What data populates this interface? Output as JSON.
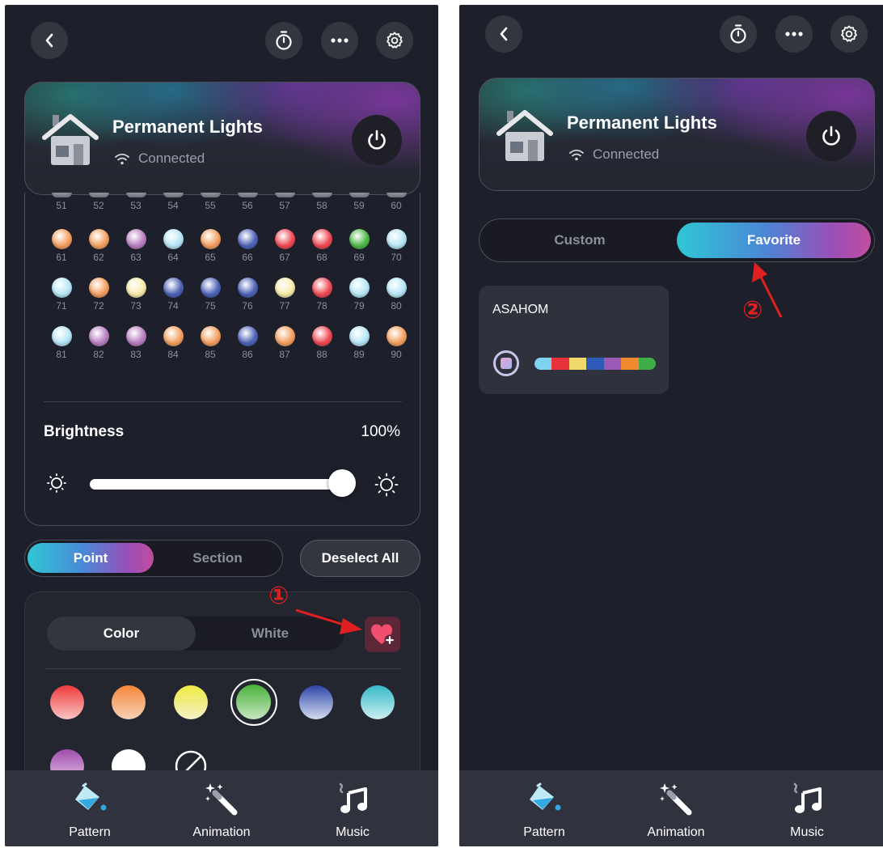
{
  "left": {
    "device": {
      "name": "Permanent Lights",
      "status": "Connected"
    },
    "bulbs": {
      "partial_row": [
        "51",
        "52",
        "53",
        "54",
        "55",
        "56",
        "57",
        "58",
        "59",
        "60"
      ],
      "rows": [
        [
          {
            "n": "61",
            "c": "orange"
          },
          {
            "n": "62",
            "c": "orange"
          },
          {
            "n": "63",
            "c": "purple"
          },
          {
            "n": "64",
            "c": "light-blue"
          },
          {
            "n": "65",
            "c": "orange"
          },
          {
            "n": "66",
            "c": "blue"
          },
          {
            "n": "67",
            "c": "red"
          },
          {
            "n": "68",
            "c": "red"
          },
          {
            "n": "69",
            "c": "green"
          },
          {
            "n": "70",
            "c": "light-blue"
          }
        ],
        [
          {
            "n": "71",
            "c": "light-blue"
          },
          {
            "n": "72",
            "c": "orange"
          },
          {
            "n": "73",
            "c": "yellow"
          },
          {
            "n": "74",
            "c": "blue"
          },
          {
            "n": "75",
            "c": "blue"
          },
          {
            "n": "76",
            "c": "blue"
          },
          {
            "n": "77",
            "c": "yellow"
          },
          {
            "n": "78",
            "c": "red"
          },
          {
            "n": "79",
            "c": "light-blue"
          },
          {
            "n": "80",
            "c": "light-blue"
          }
        ],
        [
          {
            "n": "81",
            "c": "light-blue"
          },
          {
            "n": "82",
            "c": "purple"
          },
          {
            "n": "83",
            "c": "purple"
          },
          {
            "n": "84",
            "c": "orange"
          },
          {
            "n": "85",
            "c": "orange"
          },
          {
            "n": "86",
            "c": "blue"
          },
          {
            "n": "87",
            "c": "orange"
          },
          {
            "n": "88",
            "c": "red"
          },
          {
            "n": "89",
            "c": "light-blue"
          },
          {
            "n": "90",
            "c": "orange"
          }
        ]
      ]
    },
    "brightness": {
      "label": "Brightness",
      "value_text": "100%",
      "level": 1.0
    },
    "mode_toggle": {
      "active": "Point",
      "inactive": "Section"
    },
    "deselect_label": "Deselect All",
    "color_toggle": {
      "active": "Color",
      "inactive": "White"
    },
    "swatches": [
      "red",
      "orange",
      "yellow",
      "green",
      "blue",
      "teal",
      "purple",
      "white",
      "none"
    ],
    "selected_swatch": "green",
    "annotation": "①"
  },
  "right": {
    "device": {
      "name": "Permanent Lights",
      "status": "Connected"
    },
    "tabs": {
      "inactive": "Custom",
      "active": "Favorite"
    },
    "favorite": {
      "title": "ASAHOM",
      "strip_colors": [
        "#7fd3f0",
        "#e8323a",
        "#f0d86a",
        "#2f5bb8",
        "#9b59b6",
        "#f08a2e",
        "#3fae49"
      ]
    },
    "annotation": "②"
  },
  "nav": {
    "pattern": "Pattern",
    "animation": "Animation",
    "music": "Music"
  },
  "bulb_colors": {
    "orange": "#f4a060",
    "purple": "#b97fc2",
    "light-blue": "#b7e6f6",
    "blue": "#4e63b6",
    "red": "#ef4a56",
    "green": "#4fb84a",
    "yellow": "#f6ebaa"
  },
  "colors": {
    "accent_start": "#2fc7d4",
    "accent_end": "#c04d9e",
    "annotation_red": "#e02020",
    "background": "#1d1f2a"
  }
}
